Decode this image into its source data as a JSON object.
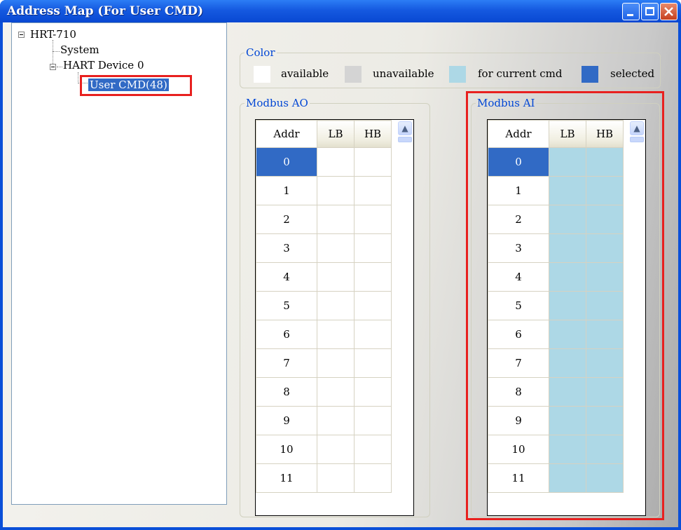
{
  "window": {
    "title": "Address Map (For User CMD)"
  },
  "tree": {
    "root": "HRT-710",
    "system": "System",
    "device": "HART Device 0",
    "selected": "User CMD(48)"
  },
  "legend": {
    "group": "Color",
    "items": [
      {
        "label": "available",
        "color": "#ffffff"
      },
      {
        "label": "unavailable",
        "color": "#d4d4d4"
      },
      {
        "label": "for current cmd",
        "color": "#add8e6"
      },
      {
        "label": "selected",
        "color": "#316ac5"
      }
    ]
  },
  "ao": {
    "group": "Modbus AO",
    "headers": [
      "Addr",
      "LB",
      "HB"
    ],
    "rows": [
      "0",
      "1",
      "2",
      "3",
      "4",
      "5",
      "6",
      "7",
      "8",
      "9",
      "10",
      "11"
    ]
  },
  "ai": {
    "group": "Modbus AI",
    "headers": [
      "Addr",
      "LB",
      "HB"
    ],
    "rows": [
      "0",
      "1",
      "2",
      "3",
      "4",
      "5",
      "6",
      "7",
      "8",
      "9",
      "10",
      "11"
    ]
  },
  "colors": {
    "titlebar": "#0a4fd8",
    "selected": "#316ac5",
    "current_cmd": "#add8e6",
    "highlight": "#e8201f"
  }
}
